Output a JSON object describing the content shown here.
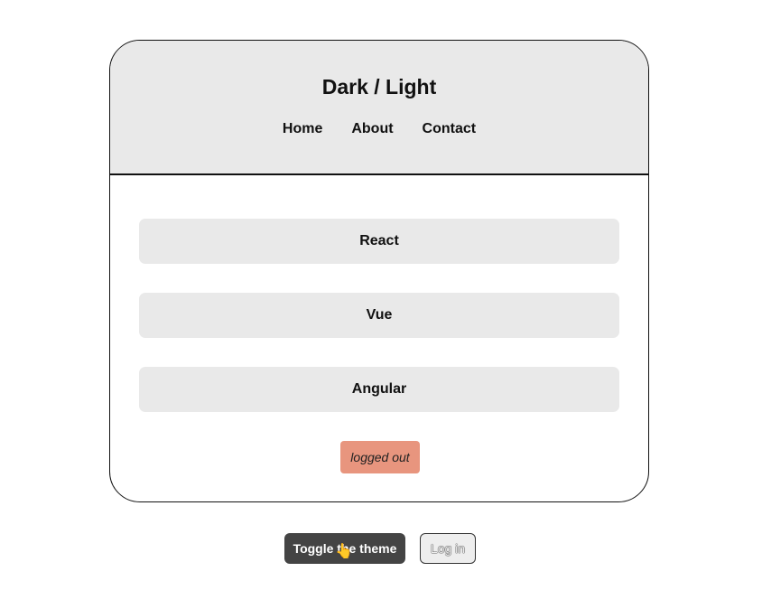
{
  "header": {
    "title": "Dark / Light",
    "nav": [
      "Home",
      "About",
      "Contact"
    ]
  },
  "frameworks": [
    "React",
    "Vue",
    "Angular"
  ],
  "status": {
    "label": "logged out",
    "color": "#e8957e"
  },
  "controls": {
    "toggle_label": "Toggle the theme",
    "login_label": "Log in"
  }
}
